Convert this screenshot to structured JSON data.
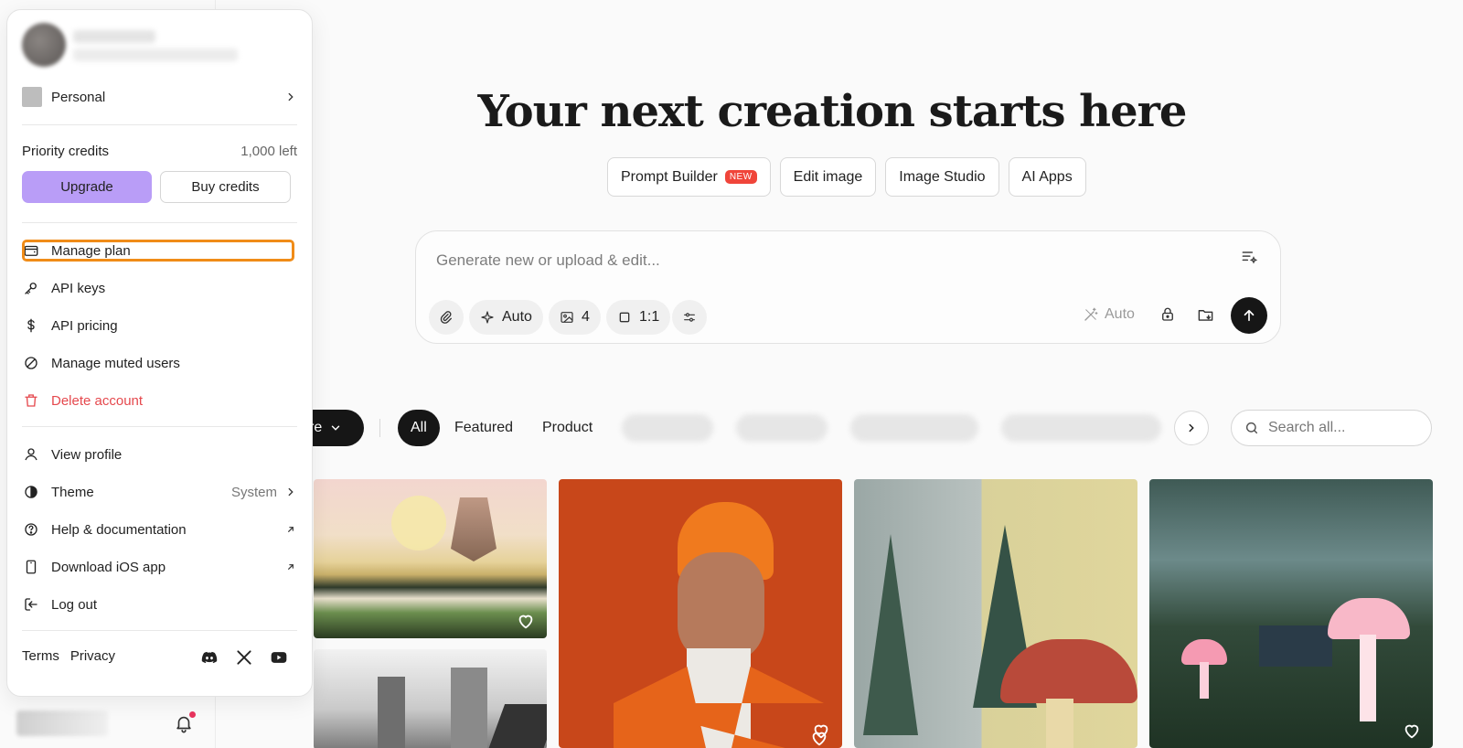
{
  "menu": {
    "workspace": "Personal",
    "credits": {
      "title": "Priority credits",
      "left": "1,000 left"
    },
    "upgrade_label": "Upgrade",
    "buy_label": "Buy credits",
    "items_a": [
      {
        "label": "Manage plan",
        "icon": "wallet-icon"
      },
      {
        "label": "API keys",
        "icon": "key-icon"
      },
      {
        "label": "API pricing",
        "icon": "dollar-icon"
      },
      {
        "label": "Manage muted users",
        "icon": "ban-icon"
      },
      {
        "label": "Delete account",
        "icon": "trash-icon",
        "danger": true
      }
    ],
    "items_b": [
      {
        "label": "View profile",
        "icon": "user-icon"
      },
      {
        "label": "Theme",
        "icon": "contrast-icon",
        "value": "System"
      },
      {
        "label": "Help & documentation",
        "icon": "help-icon"
      },
      {
        "label": "Download iOS app",
        "icon": "phone-icon"
      },
      {
        "label": "Log out",
        "icon": "logout-icon"
      }
    ],
    "footer": {
      "terms": "Terms",
      "privacy": "Privacy"
    }
  },
  "main": {
    "headline": "Your next creation starts here",
    "pills": [
      {
        "label": "Prompt Builder",
        "badge": "NEW"
      },
      {
        "label": "Edit image"
      },
      {
        "label": "Image Studio"
      },
      {
        "label": "AI Apps"
      }
    ],
    "prompt": {
      "placeholder": "Generate new or upload & edit...",
      "tools": {
        "style": "Auto",
        "count": "4",
        "ratio": "1:1"
      },
      "auto_right": "Auto"
    },
    "filters": {
      "explore": "re",
      "all": "All",
      "featured": "Featured",
      "product": "Product",
      "search_placeholder": "Search all..."
    }
  },
  "colors": {
    "accent": "#b99df7",
    "danger": "#e5484d",
    "highlight": "#f08c18",
    "dark": "#161616"
  }
}
